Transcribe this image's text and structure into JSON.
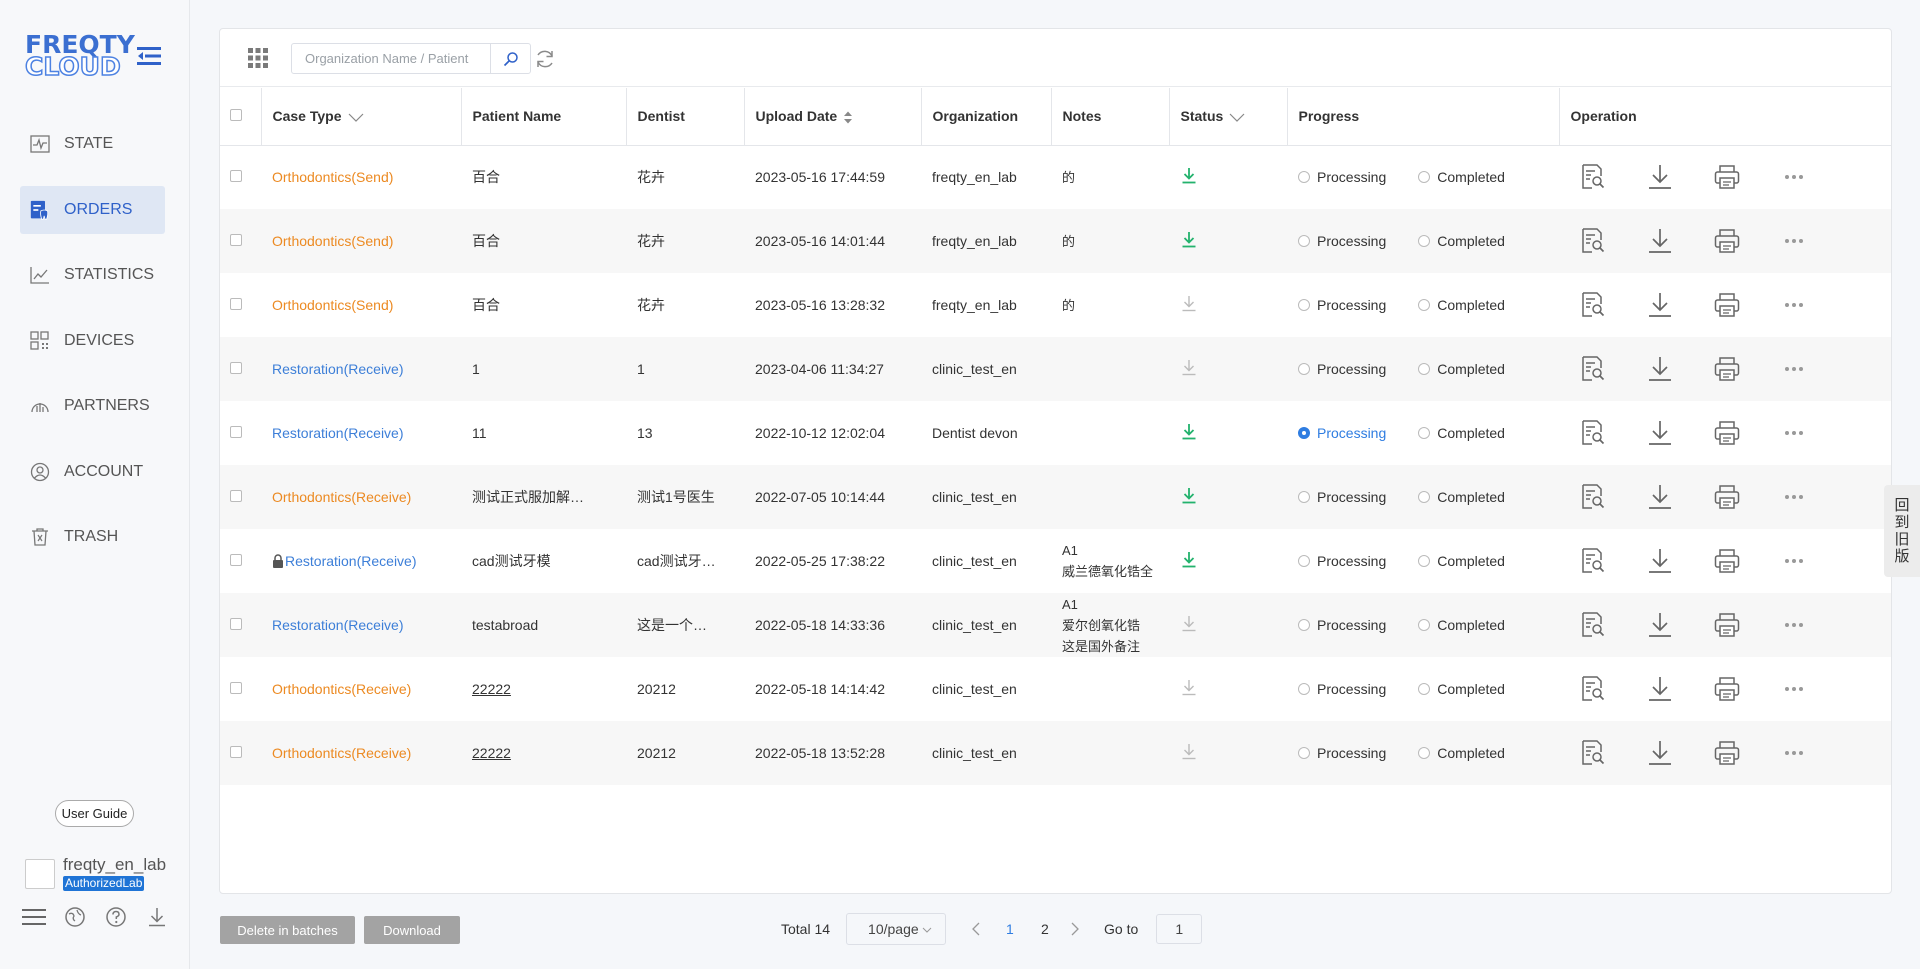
{
  "logo": {
    "line1": "FREQTY",
    "line2": "CLOUD"
  },
  "nav": [
    {
      "label": "STATE",
      "icon": "pulse-chart-icon",
      "active": false
    },
    {
      "label": "ORDERS",
      "icon": "orders-icon",
      "active": true
    },
    {
      "label": "STATISTICS",
      "icon": "line-chart-icon",
      "active": false
    },
    {
      "label": "DEVICES",
      "icon": "devices-icon",
      "active": false
    },
    {
      "label": "PARTNERS",
      "icon": "partners-icon",
      "active": false
    },
    {
      "label": "ACCOUNT",
      "icon": "account-icon",
      "active": false
    },
    {
      "label": "TRASH",
      "icon": "trash-icon",
      "active": false
    }
  ],
  "sidebar_footer": {
    "guide_label": "User Guide",
    "user_name": "freqty_en_lab",
    "user_role": "AuthorizedLab"
  },
  "search": {
    "placeholder": "Organization Name / Patient"
  },
  "table": {
    "headers": {
      "case_type": "Case Type",
      "patient_name": "Patient Name",
      "dentist": "Dentist",
      "upload_date": "Upload Date",
      "organization": "Organization",
      "notes": "Notes",
      "status": "Status",
      "progress": "Progress",
      "operation": "Operation"
    },
    "progress_labels": {
      "processing": "Processing",
      "completed": "Completed"
    },
    "rows": [
      {
        "case_type": "Orthodontics(Send)",
        "type_color": "orange",
        "locked": false,
        "patient": "百合",
        "patient_link": false,
        "dentist": "花卉",
        "date": "2023-05-16 17:44:59",
        "org": "freqty_en_lab",
        "notes": [
          "的"
        ],
        "status_ready": true,
        "progress": "none"
      },
      {
        "case_type": "Orthodontics(Send)",
        "type_color": "orange",
        "locked": false,
        "patient": "百合",
        "patient_link": false,
        "dentist": "花卉",
        "date": "2023-05-16 14:01:44",
        "org": "freqty_en_lab",
        "notes": [
          "的"
        ],
        "status_ready": true,
        "progress": "none"
      },
      {
        "case_type": "Orthodontics(Send)",
        "type_color": "orange",
        "locked": false,
        "patient": "百合",
        "patient_link": false,
        "dentist": "花卉",
        "date": "2023-05-16 13:28:32",
        "org": "freqty_en_lab",
        "notes": [
          "的"
        ],
        "status_ready": false,
        "progress": "none"
      },
      {
        "case_type": "Restoration(Receive)",
        "type_color": "blue",
        "locked": false,
        "patient": "1",
        "patient_link": false,
        "dentist": "1",
        "date": "2023-04-06 11:34:27",
        "org": "clinic_test_en",
        "notes": [],
        "status_ready": false,
        "progress": "none"
      },
      {
        "case_type": "Restoration(Receive)",
        "type_color": "blue",
        "locked": false,
        "patient": "11",
        "patient_link": false,
        "dentist": "13",
        "date": "2022-10-12 12:02:04",
        "org": "Dentist devon",
        "notes": [],
        "status_ready": true,
        "progress": "processing"
      },
      {
        "case_type": "Orthodontics(Receive)",
        "type_color": "orange",
        "locked": false,
        "patient": "测试正式服加解…",
        "patient_link": false,
        "dentist": "测试1号医生",
        "date": "2022-07-05 10:14:44",
        "org": "clinic_test_en",
        "notes": [],
        "status_ready": true,
        "progress": "none"
      },
      {
        "case_type": "Restoration(Receive)",
        "type_color": "blue",
        "locked": true,
        "patient": "cad测试牙模",
        "patient_link": false,
        "dentist": "cad测试牙…",
        "date": "2022-05-25 17:38:22",
        "org": "clinic_test_en",
        "notes": [
          "A1",
          "威兰德氧化锆全"
        ],
        "status_ready": true,
        "progress": "none"
      },
      {
        "case_type": "Restoration(Receive)",
        "type_color": "blue",
        "locked": false,
        "patient": "testabroad",
        "patient_link": false,
        "dentist": "这是一个…",
        "date": "2022-05-18 14:33:36",
        "org": "clinic_test_en",
        "notes": [
          "A1",
          "爱尔创氧化锆",
          "这是国外备注"
        ],
        "status_ready": false,
        "progress": "none"
      },
      {
        "case_type": "Orthodontics(Receive)",
        "type_color": "orange",
        "locked": false,
        "patient": "22222",
        "patient_link": true,
        "dentist": "20212",
        "date": "2022-05-18 14:14:42",
        "org": "clinic_test_en",
        "notes": [],
        "status_ready": false,
        "progress": "none"
      },
      {
        "case_type": "Orthodontics(Receive)",
        "type_color": "orange",
        "locked": false,
        "patient": "22222",
        "patient_link": true,
        "dentist": "20212",
        "date": "2022-05-18 13:52:28",
        "org": "clinic_test_en",
        "notes": [],
        "status_ready": false,
        "progress": "none"
      }
    ]
  },
  "footer": {
    "delete_label": "Delete in batches",
    "download_label": "Download",
    "total_text": "Total 14",
    "page_size": "10/page",
    "pages": [
      "1",
      "2"
    ],
    "current_page": "1",
    "goto_label": "Go to",
    "goto_value": "1"
  },
  "old_version_chars": [
    "回",
    "到",
    "旧",
    "版"
  ],
  "colors": {
    "accent": "#2f7de1",
    "orange": "#ec8a22",
    "blue": "#3d7fd8",
    "green": "#23b26d"
  }
}
